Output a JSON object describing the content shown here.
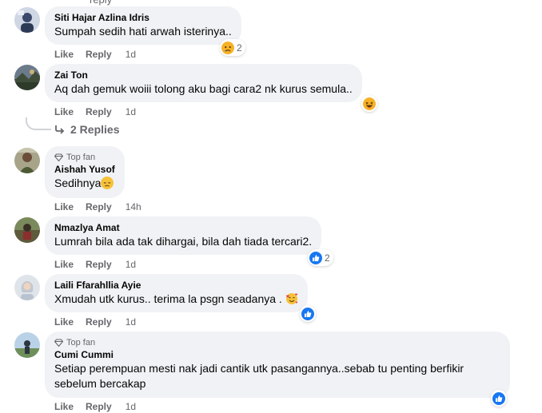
{
  "colors": {
    "bubble_bg": "#f0f2f5",
    "muted_text": "#65676b",
    "like_blue": "#1877f2",
    "haha_yellow": "#f7b125"
  },
  "top_partial": "reply",
  "comments": [
    {
      "author": "Siti Hajar Azlina Idris",
      "text": "Sumpah sedih hati arwah isterinya..",
      "like": "Like",
      "reply": "Reply",
      "time": "1d",
      "reaction_icons": [
        "sad-react-icon"
      ],
      "reaction_count": "2"
    },
    {
      "author": "Zai Ton",
      "text": "Aq dah gemuk woiii tolong aku bagi cara2 nk kurus semula..",
      "like": "Like",
      "reply": "Reply",
      "time": "1d",
      "reaction_icons": [
        "haha-react-icon"
      ],
      "replies_label": "2 Replies"
    },
    {
      "badge": "Top fan",
      "author": "Aishah Yusof",
      "text": "Sedihnya",
      "like": "Like",
      "reply": "Reply",
      "time": "14h"
    },
    {
      "author": "Nmazlya Amat",
      "text": "Lumrah bila ada tak dihargai, bila dah tiada tercari2.",
      "like": "Like",
      "reply": "Reply",
      "time": "1d",
      "reaction_icons": [
        "like-react-icon"
      ],
      "reaction_count": "2"
    },
    {
      "author": "Laili Ffarahllia Ayie",
      "text": "Xmudah utk kurus.. terima la psgn seadanya .",
      "like": "Like",
      "reply": "Reply",
      "time": "1d",
      "reaction_icons": [
        "like-react-icon"
      ]
    },
    {
      "badge": "Top fan",
      "author": "Cumi Cummi",
      "text": "Setiap perempuan mesti nak jadi cantik utk pasangannya..sebab tu penting berfikir sebelum bercakap",
      "like": "Like",
      "reply": "Reply",
      "time": "1d",
      "reaction_icons": [
        "like-react-icon"
      ]
    }
  ]
}
